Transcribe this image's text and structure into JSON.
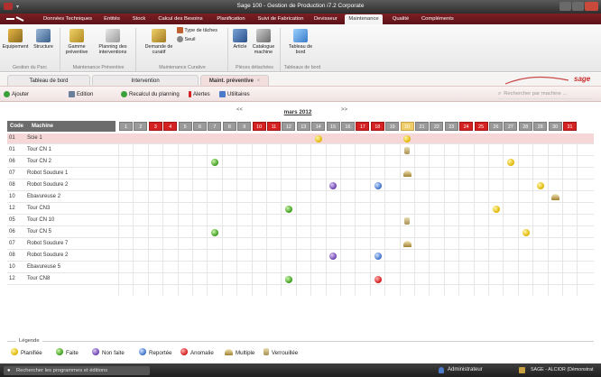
{
  "window": {
    "title": "Sage 100 - Gestion de Production i7.2 Corporate"
  },
  "menu": [
    {
      "label": "Données Techniques"
    },
    {
      "label": "Entités"
    },
    {
      "label": "Stock"
    },
    {
      "label": "Calcul des Besoins"
    },
    {
      "label": "Planification"
    },
    {
      "label": "Suivi de Fabrication"
    },
    {
      "label": "Devisseur"
    },
    {
      "label": "Maintenance",
      "active": true
    },
    {
      "label": "Qualité"
    },
    {
      "label": "Compléments"
    }
  ],
  "ribbon": {
    "buttons": {
      "equipement": "Equipement",
      "structure": "Structure",
      "gamme": "Gamme préventive",
      "planning": "Planning des interventions",
      "demande": "Demande de curatif",
      "type_taches": "Type de tâches",
      "seuil": "Seuil",
      "article": "Article",
      "catalogue": "Catalogue machine",
      "tableau": "Tableau de bord"
    },
    "groups": {
      "parc": "Gestion du Parc",
      "preventive": "Maintenance Préventive",
      "curative": "Maintenance Curative",
      "pieces": "Pièces détachées",
      "tdb": "Tableaux de bord"
    }
  },
  "tabs": [
    {
      "label": "Tableau de bord"
    },
    {
      "label": "Intervention"
    },
    {
      "label": "Maint. préventive",
      "active": true
    }
  ],
  "actions": {
    "ajouter": "Ajouter",
    "edition": "Edition",
    "recalcul": "Recalcul du planning",
    "alertes": "Alertes",
    "utilitaires": "Utilitaires",
    "search_placeholder": "Rechercher par machine ..."
  },
  "nav": {
    "prev": "<<",
    "next": ">>",
    "month": "mars 2012"
  },
  "grid": {
    "code_header": "Code",
    "machine_header": "Machine",
    "days": [
      1,
      2,
      3,
      4,
      5,
      6,
      7,
      8,
      9,
      10,
      11,
      12,
      13,
      14,
      15,
      16,
      17,
      18,
      19,
      20,
      21,
      22,
      23,
      24,
      25,
      26,
      27,
      28,
      29,
      30,
      31
    ],
    "red_days": [
      3,
      4,
      10,
      11,
      17,
      18,
      24,
      25,
      31
    ],
    "today": 20,
    "rows": [
      {
        "code": "01",
        "machine": "Scie 1",
        "selected": true,
        "marks": [
          {
            "day": 14,
            "type": "planifiee"
          },
          {
            "day": 20,
            "type": "planifiee"
          }
        ]
      },
      {
        "code": "01",
        "machine": "Tour CN 1",
        "marks": [
          {
            "day": 20,
            "type": "verrou"
          }
        ]
      },
      {
        "code": "06",
        "machine": "Tour CN 2",
        "marks": [
          {
            "day": 7,
            "type": "faite"
          },
          {
            "day": 27,
            "type": "planifiee"
          }
        ]
      },
      {
        "code": "07",
        "machine": "Robot Soudure 1",
        "marks": [
          {
            "day": 20,
            "type": "multiple"
          }
        ]
      },
      {
        "code": "08",
        "machine": "Robot Soudure 2",
        "marks": [
          {
            "day": 15,
            "type": "nonfaite"
          },
          {
            "day": 18,
            "type": "reportee"
          },
          {
            "day": 29,
            "type": "planifiee"
          }
        ]
      },
      {
        "code": "10",
        "machine": "Ebavureuse 2",
        "marks": [
          {
            "day": 30,
            "type": "multiple"
          }
        ]
      },
      {
        "code": "12",
        "machine": "Tour CN3",
        "marks": [
          {
            "day": 12,
            "type": "faite"
          },
          {
            "day": 26,
            "type": "planifiee"
          }
        ]
      },
      {
        "code": "05",
        "machine": "Tour CN 10",
        "marks": [
          {
            "day": 20,
            "type": "verrou"
          }
        ]
      },
      {
        "code": "06",
        "machine": "Tour CN 5",
        "marks": [
          {
            "day": 7,
            "type": "faite"
          },
          {
            "day": 28,
            "type": "planifiee"
          }
        ]
      },
      {
        "code": "07",
        "machine": "Robot Soudure 7",
        "marks": [
          {
            "day": 20,
            "type": "multiple"
          }
        ]
      },
      {
        "code": "08",
        "machine": "Robot Soudure 2",
        "marks": [
          {
            "day": 15,
            "type": "nonfaite"
          },
          {
            "day": 18,
            "type": "reportee"
          }
        ]
      },
      {
        "code": "10",
        "machine": "Ebavureuse 5",
        "marks": []
      },
      {
        "code": "12",
        "machine": "Tour CN8",
        "marks": [
          {
            "day": 12,
            "type": "faite"
          },
          {
            "day": 18,
            "type": "anomalie"
          }
        ]
      }
    ]
  },
  "legend": {
    "title": "Légende",
    "items": [
      {
        "type": "planifiee",
        "label": "Planifiée"
      },
      {
        "type": "faite",
        "label": "Faite"
      },
      {
        "type": "nonfaite",
        "label": "Non faite"
      },
      {
        "type": "reportee",
        "label": "Reportée"
      },
      {
        "type": "anomalie",
        "label": "Anomalie"
      },
      {
        "type": "multiple",
        "label": "Multiple"
      },
      {
        "type": "verrou",
        "label": "Verrouillée"
      }
    ]
  },
  "status": {
    "search": "Rechercher les programmes et éditions",
    "user": "Administrateur",
    "company": "SAGE - ALCIOR (Démonstrat"
  },
  "colors": {
    "brand": "#7c1f24",
    "red_day": "#d42121",
    "today": "#efcd6a",
    "selected_row": "#f6d7d7"
  }
}
